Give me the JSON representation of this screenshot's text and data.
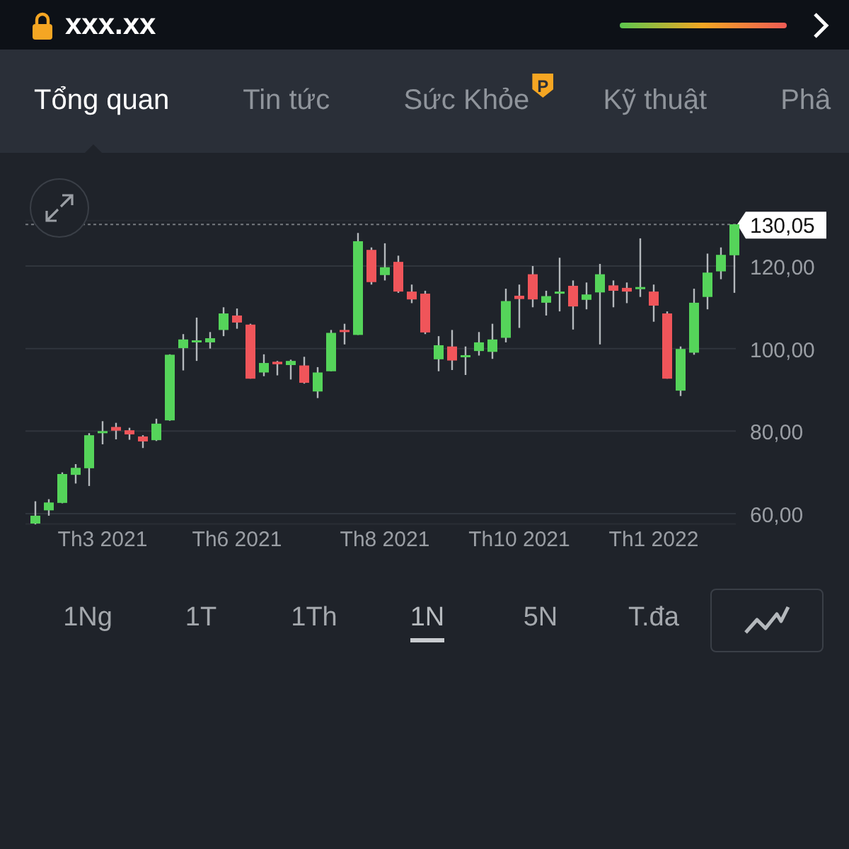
{
  "header": {
    "title": "xxx.xx"
  },
  "tabs": [
    {
      "label": "Tổng quan",
      "selected": true
    },
    {
      "label": "Tin tức",
      "selected": false
    },
    {
      "label": "Sức Khỏe",
      "selected": false,
      "badge": "P"
    },
    {
      "label": "Kỹ thuật",
      "selected": false
    },
    {
      "label": "Phâ",
      "selected": false
    }
  ],
  "chart": {
    "chart_data": {
      "type": "candlestick",
      "categories": [
        null,
        null,
        null,
        null,
        null,
        "Th3 2021",
        null,
        null,
        null,
        null,
        null,
        null,
        null,
        null,
        null,
        "Th6 2021",
        null,
        null,
        null,
        null,
        null,
        null,
        null,
        null,
        null,
        null,
        "Th8 2021",
        null,
        null,
        null,
        null,
        null,
        null,
        null,
        null,
        null,
        "Th10 2021",
        null,
        null,
        null,
        null,
        null,
        null,
        null,
        null,
        null,
        "Th1 2022",
        null,
        null,
        null,
        null,
        null,
        null
      ],
      "ohlc": [
        [
          57.6,
          63,
          57.4,
          59.5
        ],
        [
          60.8,
          63.5,
          59.5,
          62.7
        ],
        [
          62.6,
          70,
          62.5,
          69.6
        ],
        [
          69.4,
          72,
          67.3,
          71.1
        ],
        [
          71,
          79.5,
          66.7,
          79
        ],
        [
          79.8,
          82.4,
          76.8,
          80
        ],
        [
          81,
          82,
          78,
          80.1
        ],
        [
          80.2,
          80.8,
          77.9,
          79.2
        ],
        [
          78.7,
          79,
          75.9,
          77.5
        ],
        [
          77.8,
          83,
          77.6,
          81.8
        ],
        [
          82.6,
          98.6,
          82.5,
          98.5
        ],
        [
          100.1,
          103.5,
          94.7,
          102.2
        ],
        [
          101.9,
          107.5,
          97,
          102
        ],
        [
          101.5,
          104,
          100,
          102.5
        ],
        [
          104.5,
          110,
          103,
          108.5
        ],
        [
          108,
          109.7,
          104.8,
          106.3
        ],
        [
          105.8,
          106,
          92.7,
          92.7
        ],
        [
          94.2,
          98.6,
          93.3,
          96.5
        ],
        [
          96.8,
          97,
          93.5,
          96.2
        ],
        [
          96,
          97.3,
          92.5,
          97
        ],
        [
          95.9,
          98,
          91.5,
          91.7
        ],
        [
          89.6,
          95.5,
          88,
          94.2
        ],
        [
          94.5,
          104.5,
          94.5,
          103.8
        ],
        [
          104.5,
          106,
          101,
          104.2
        ],
        [
          103.3,
          128,
          103.3,
          126
        ],
        [
          123.9,
          124.5,
          115.5,
          116.1
        ],
        [
          117.8,
          125.5,
          116.5,
          119.7
        ],
        [
          121,
          122.5,
          113.5,
          113.8
        ],
        [
          113.8,
          115.5,
          111,
          111.9
        ],
        [
          113.3,
          114,
          103.5,
          103.9
        ],
        [
          97.4,
          103,
          94.5,
          100.8
        ],
        [
          100.5,
          104.5,
          94.8,
          97.1
        ],
        [
          98,
          100.5,
          93.6,
          98.4
        ],
        [
          99.4,
          104,
          98.3,
          101.5
        ],
        [
          99.2,
          106,
          97.5,
          102.2
        ],
        [
          102.6,
          114.5,
          101.5,
          111.5
        ],
        [
          112.8,
          115.5,
          105,
          112
        ],
        [
          118,
          120,
          110,
          111.9
        ],
        [
          111.1,
          114,
          108,
          112.7
        ],
        [
          113.8,
          122,
          109,
          113.8
        ],
        [
          115.2,
          116.5,
          104.6,
          110.2
        ],
        [
          111.8,
          116,
          109.5,
          113.1
        ],
        [
          113.6,
          120.5,
          101,
          118
        ],
        [
          115.3,
          116.5,
          110,
          114
        ],
        [
          114.7,
          116,
          111,
          113.8
        ],
        [
          114.5,
          126.7,
          112.5,
          114.9
        ],
        [
          113.8,
          115.5,
          106.5,
          110.4
        ],
        [
          108.5,
          109,
          92.7,
          92.7
        ],
        [
          89.8,
          100.5,
          88.5,
          99.9
        ],
        [
          99,
          114.5,
          98.5,
          111.1
        ],
        [
          112.5,
          123,
          109.5,
          118.4
        ],
        [
          118.7,
          124.5,
          116.8,
          122.7
        ],
        [
          122.6,
          130.1,
          113.5,
          130.1
        ]
      ],
      "ylim": [
        57.5,
        131
      ],
      "grid": true,
      "yticks": [
        {
          "value": 60,
          "label": "60,00"
        },
        {
          "value": 80,
          "label": "80,00"
        },
        {
          "value": 100,
          "label": "100,00"
        },
        {
          "value": 120,
          "label": "120,00"
        }
      ],
      "ref_lines": [
        {
          "axis": "y",
          "value": 130.05,
          "label": "130,05"
        }
      ]
    }
  },
  "ranges": [
    {
      "label": "1Ng",
      "selected": false
    },
    {
      "label": "1T",
      "selected": false
    },
    {
      "label": "1Th",
      "selected": false
    },
    {
      "label": "1N",
      "selected": true
    },
    {
      "label": "5N",
      "selected": false
    },
    {
      "label": "T.đa",
      "selected": false
    }
  ]
}
